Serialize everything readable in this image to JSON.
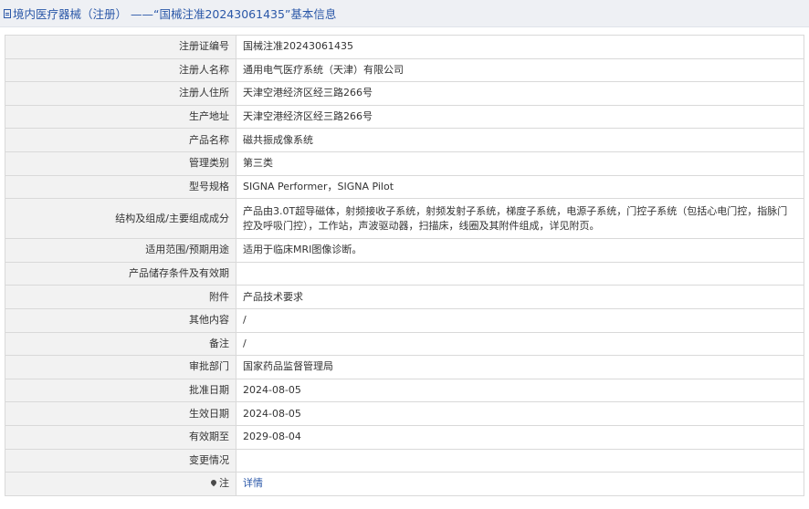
{
  "header": {
    "title": "境内医疗器械（注册） ——“国械注准20243061435”基本信息",
    "icon": "document-icon"
  },
  "fields": [
    {
      "label": "注册证编号",
      "value": "国械注准20243061435"
    },
    {
      "label": "注册人名称",
      "value": "通用电气医疗系统（天津）有限公司"
    },
    {
      "label": "注册人住所",
      "value": "天津空港经济区经三路266号"
    },
    {
      "label": "生产地址",
      "value": "天津空港经济区经三路266号"
    },
    {
      "label": "产品名称",
      "value": "磁共振成像系统"
    },
    {
      "label": "管理类别",
      "value": "第三类"
    },
    {
      "label": "型号规格",
      "value": "SIGNA Performer，SIGNA Pilot"
    },
    {
      "label": "结构及组成/主要组成成分",
      "value": "产品由3.0T超导磁体，射频接收子系统，射频发射子系统，梯度子系统，电源子系统，门控子系统（包括心电门控，指脉门控及呼吸门控），工作站，声波驱动器，扫描床，线圈及其附件组成，详见附页。"
    },
    {
      "label": "适用范围/预期用途",
      "value": "适用于临床MRI图像诊断。"
    },
    {
      "label": "产品储存条件及有效期",
      "value": ""
    },
    {
      "label": "附件",
      "value": "产品技术要求"
    },
    {
      "label": "其他内容",
      "value": "/"
    },
    {
      "label": "备注",
      "value": "/"
    },
    {
      "label": "审批部门",
      "value": "国家药品监督管理局"
    },
    {
      "label": "批准日期",
      "value": "2024-08-05"
    },
    {
      "label": "生效日期",
      "value": "2024-08-05"
    },
    {
      "label": "有效期至",
      "value": "2029-08-04"
    },
    {
      "label": "变更情况",
      "value": ""
    }
  ],
  "note": {
    "label": "注",
    "icon": "location-pin-icon",
    "link_text": "详情"
  }
}
